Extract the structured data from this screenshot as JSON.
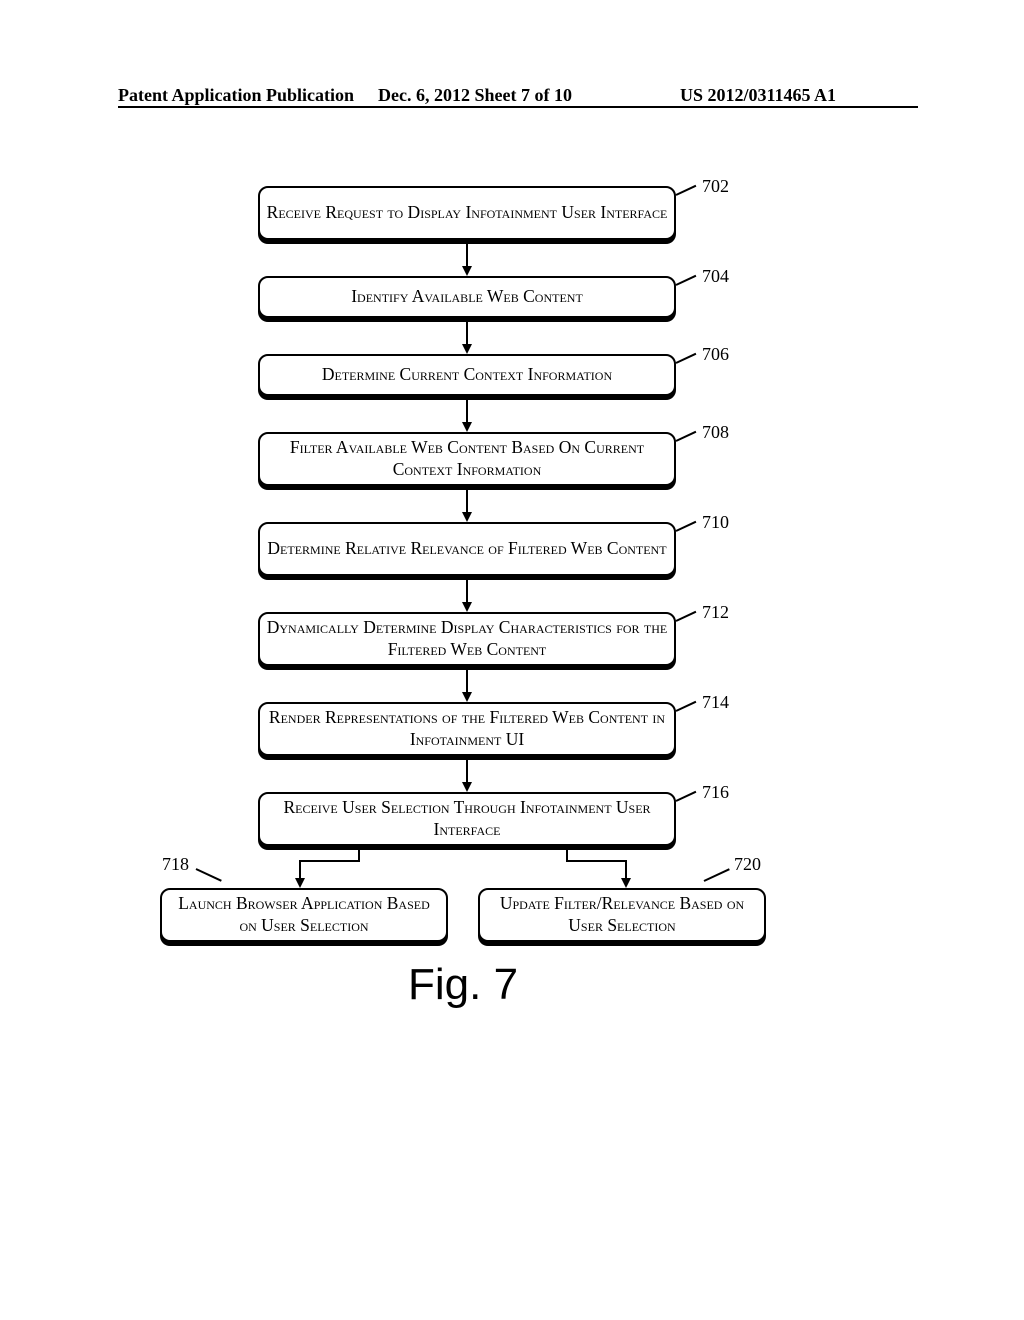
{
  "header": {
    "left": "Patent Application Publication",
    "center": "Dec. 6, 2012  Sheet 7 of 10",
    "right": "US 2012/0311465 A1"
  },
  "boxes": {
    "b702": "Receive Request to Display Infotainment User Interface",
    "b704": "Identify Available Web Content",
    "b706": "Determine Current Context Information",
    "b708": "Filter Available Web Content Based On Current Context Information",
    "b710": "Determine Relative Relevance of Filtered Web Content",
    "b712": "Dynamically Determine Display Characteristics for the Filtered Web Content",
    "b714": "Render Representations of the Filtered Web Content in Infotainment UI",
    "b716": "Receive User Selection Through Infotainment User Interface",
    "b718": "Launch Browser Application Based on User Selection",
    "b720": "Update Filter/Relevance Based on User Selection"
  },
  "labels": {
    "l702": "702",
    "l704": "704",
    "l706": "706",
    "l708": "708",
    "l710": "710",
    "l712": "712",
    "l714": "714",
    "l716": "716",
    "l718": "718",
    "l720": "720"
  },
  "figure": "Fig. 7"
}
